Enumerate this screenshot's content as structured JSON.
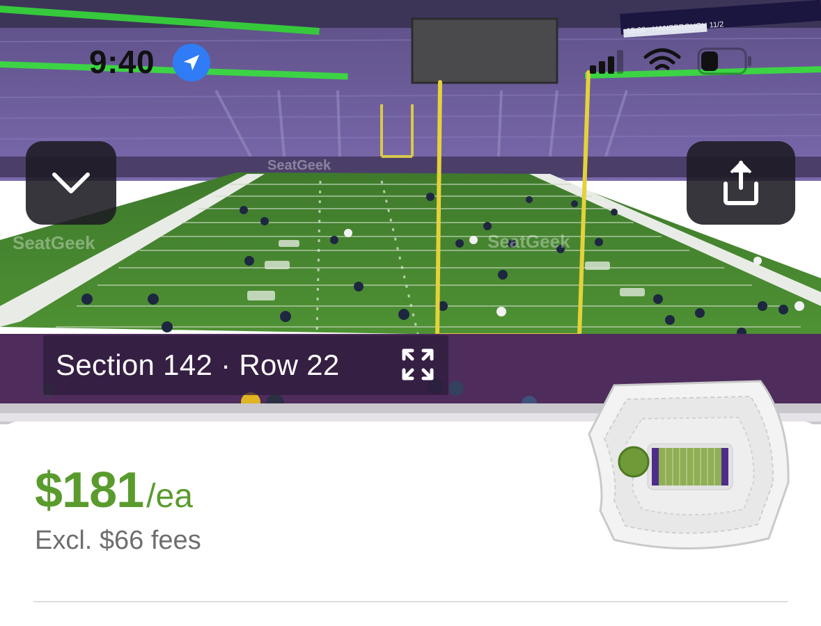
{
  "status_bar": {
    "time": "9:40",
    "location_icon": "location-arrow-icon",
    "signal_icon": "cellular-signal-icon",
    "wifi_icon": "wifi-icon",
    "battery_icon": "battery-icon"
  },
  "photo": {
    "watermark": "SeatGeek",
    "scoreboard_ticker": "15:00 · HANSBROUGH 11/2"
  },
  "controls": {
    "collapse_icon": "chevron-down-icon",
    "share_icon": "share-icon",
    "expand_icon": "expand-icon"
  },
  "seat": {
    "label": "Section 142 · Row 22"
  },
  "listing": {
    "price": "$181",
    "price_unit": "/ea",
    "fees": "Excl. $66 fees"
  },
  "colors": {
    "price_green": "#5a9b2e",
    "field_green": "#4a8a32",
    "seat_purple": "#6b5a9a",
    "marker_green": "#6e9a38",
    "accent_blue": "#2f7cf6"
  }
}
